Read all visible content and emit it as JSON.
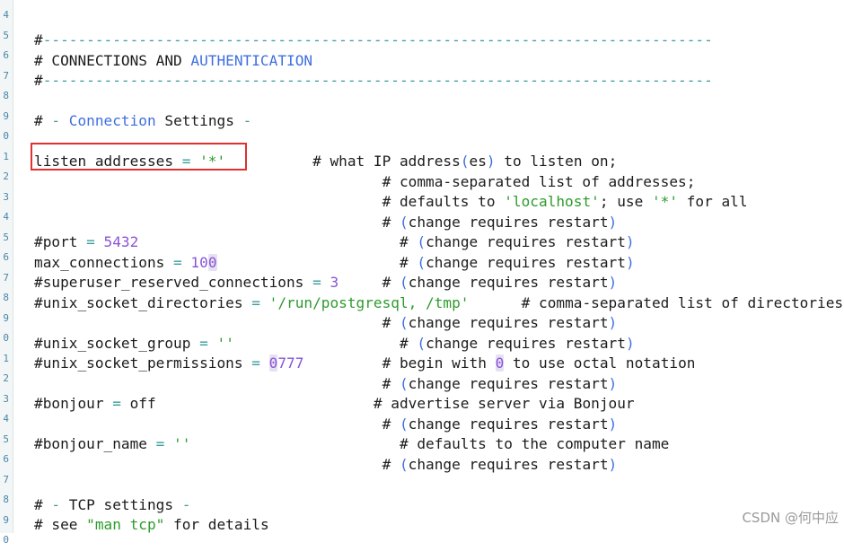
{
  "watermark": "CSDN @何中应",
  "colors": {
    "background": "#ffffff",
    "gutter_number": "#4a86a8",
    "text": "#1c1c1c",
    "operator": "#3a9c9c",
    "string": "#2e9b2e",
    "number": "#8a54d6",
    "keyword": "#3f6fe0",
    "highlight_box": "#e03030"
  },
  "gutter": [
    "4",
    "5",
    "6",
    "7",
    "8",
    "9",
    "0",
    "1",
    "2",
    "3",
    "4",
    "5",
    "6",
    "7",
    "8",
    "9",
    "0",
    "1",
    "2",
    "3",
    "4",
    "5",
    "6",
    "7",
    "8",
    "9",
    "0"
  ],
  "lines": [
    [],
    [
      {
        "t": "#",
        "c": "punct"
      },
      {
        "t": "-----------------------------------------------------------------------------",
        "c": "dim"
      }
    ],
    [
      {
        "t": "# CONNECTIONS AND ",
        "c": "text"
      },
      {
        "t": "AUTHENTICATION",
        "c": "kw"
      }
    ],
    [
      {
        "t": "#",
        "c": "punct"
      },
      {
        "t": "-----------------------------------------------------------------------------",
        "c": "dim"
      }
    ],
    [],
    [
      {
        "t": "# ",
        "c": "text"
      },
      {
        "t": "- ",
        "c": "op"
      },
      {
        "t": "Connection",
        "c": "kw"
      },
      {
        "t": " Settings ",
        "c": "text"
      },
      {
        "t": "-",
        "c": "op"
      }
    ],
    [],
    [
      {
        "t": "listen_addresses",
        "c": "key"
      },
      {
        "t": " = ",
        "c": "op"
      },
      {
        "t": "'*'",
        "c": "str"
      },
      {
        "t": "          # what IP address",
        "c": "text"
      },
      {
        "t": "(",
        "c": "paren"
      },
      {
        "t": "es",
        "c": "text"
      },
      {
        "t": ")",
        "c": "paren"
      },
      {
        "t": " to listen on;",
        "c": "text"
      }
    ],
    [
      {
        "t": "                                        # comma-separated list of addresses;",
        "c": "text"
      }
    ],
    [
      {
        "t": "                                        # defaults to ",
        "c": "text"
      },
      {
        "t": "'localhost'",
        "c": "str"
      },
      {
        "t": "; use ",
        "c": "text"
      },
      {
        "t": "'*'",
        "c": "str"
      },
      {
        "t": " for all",
        "c": "text"
      }
    ],
    [
      {
        "t": "                                        # ",
        "c": "text"
      },
      {
        "t": "(",
        "c": "paren"
      },
      {
        "t": "change requires restart",
        "c": "text"
      },
      {
        "t": ")",
        "c": "paren"
      }
    ],
    [
      {
        "t": "#port",
        "c": "key"
      },
      {
        "t": " = ",
        "c": "op"
      },
      {
        "t": "5432",
        "c": "num"
      },
      {
        "t": "                              # ",
        "c": "text"
      },
      {
        "t": "(",
        "c": "paren"
      },
      {
        "t": "change requires restart",
        "c": "text"
      },
      {
        "t": ")",
        "c": "paren"
      }
    ],
    [
      {
        "t": "max_connections",
        "c": "key"
      },
      {
        "t": " = ",
        "c": "op"
      },
      {
        "t": "10",
        "c": "num"
      },
      {
        "t": "0",
        "c": "cursor"
      },
      {
        "t": "                     # ",
        "c": "text"
      },
      {
        "t": "(",
        "c": "paren"
      },
      {
        "t": "change requires restart",
        "c": "text"
      },
      {
        "t": ")",
        "c": "paren"
      }
    ],
    [
      {
        "t": "#superuser_reserved_connections",
        "c": "key"
      },
      {
        "t": " = ",
        "c": "op"
      },
      {
        "t": "3",
        "c": "num"
      },
      {
        "t": "     # ",
        "c": "text"
      },
      {
        "t": "(",
        "c": "paren"
      },
      {
        "t": "change requires restart",
        "c": "text"
      },
      {
        "t": ")",
        "c": "paren"
      }
    ],
    [
      {
        "t": "#unix_socket_directories",
        "c": "key"
      },
      {
        "t": " = ",
        "c": "op"
      },
      {
        "t": "'/run/postgresql, /tmp'",
        "c": "str"
      },
      {
        "t": "      # comma-separated list of directories",
        "c": "text"
      }
    ],
    [
      {
        "t": "                                        # ",
        "c": "text"
      },
      {
        "t": "(",
        "c": "paren"
      },
      {
        "t": "change requires restart",
        "c": "text"
      },
      {
        "t": ")",
        "c": "paren"
      }
    ],
    [
      {
        "t": "#unix_socket_group",
        "c": "key"
      },
      {
        "t": " = ",
        "c": "op"
      },
      {
        "t": "''",
        "c": "str"
      },
      {
        "t": "                   # ",
        "c": "text"
      },
      {
        "t": "(",
        "c": "paren"
      },
      {
        "t": "change requires restart",
        "c": "text"
      },
      {
        "t": ")",
        "c": "paren"
      }
    ],
    [
      {
        "t": "#unix_socket_permissions",
        "c": "key"
      },
      {
        "t": " = ",
        "c": "op"
      },
      {
        "t": "0",
        "c": "cursor"
      },
      {
        "t": "777",
        "c": "num"
      },
      {
        "t": "         # begin with ",
        "c": "text"
      },
      {
        "t": "0",
        "c": "cursor"
      },
      {
        "t": " to use octal notation",
        "c": "text"
      }
    ],
    [
      {
        "t": "                                        # ",
        "c": "text"
      },
      {
        "t": "(",
        "c": "paren"
      },
      {
        "t": "change requires restart",
        "c": "text"
      },
      {
        "t": ")",
        "c": "paren"
      }
    ],
    [
      {
        "t": "#bonjour",
        "c": "key"
      },
      {
        "t": " = ",
        "c": "op"
      },
      {
        "t": "off",
        "c": "text"
      },
      {
        "t": "                         # advertise server via Bonjour",
        "c": "text"
      }
    ],
    [
      {
        "t": "                                        # ",
        "c": "text"
      },
      {
        "t": "(",
        "c": "paren"
      },
      {
        "t": "change requires restart",
        "c": "text"
      },
      {
        "t": ")",
        "c": "paren"
      }
    ],
    [
      {
        "t": "#bonjour_name",
        "c": "key"
      },
      {
        "t": " = ",
        "c": "op"
      },
      {
        "t": "''",
        "c": "str"
      },
      {
        "t": "                        # defaults to the computer name",
        "c": "text"
      }
    ],
    [
      {
        "t": "                                        # ",
        "c": "text"
      },
      {
        "t": "(",
        "c": "paren"
      },
      {
        "t": "change requires restart",
        "c": "text"
      },
      {
        "t": ")",
        "c": "paren"
      }
    ],
    [],
    [
      {
        "t": "# ",
        "c": "text"
      },
      {
        "t": "- ",
        "c": "op"
      },
      {
        "t": "TCP settings ",
        "c": "text"
      },
      {
        "t": "-",
        "c": "op"
      }
    ],
    [
      {
        "t": "# see ",
        "c": "text"
      },
      {
        "t": "\"man tcp\"",
        "c": "str"
      },
      {
        "t": " for details",
        "c": "text"
      }
    ]
  ]
}
